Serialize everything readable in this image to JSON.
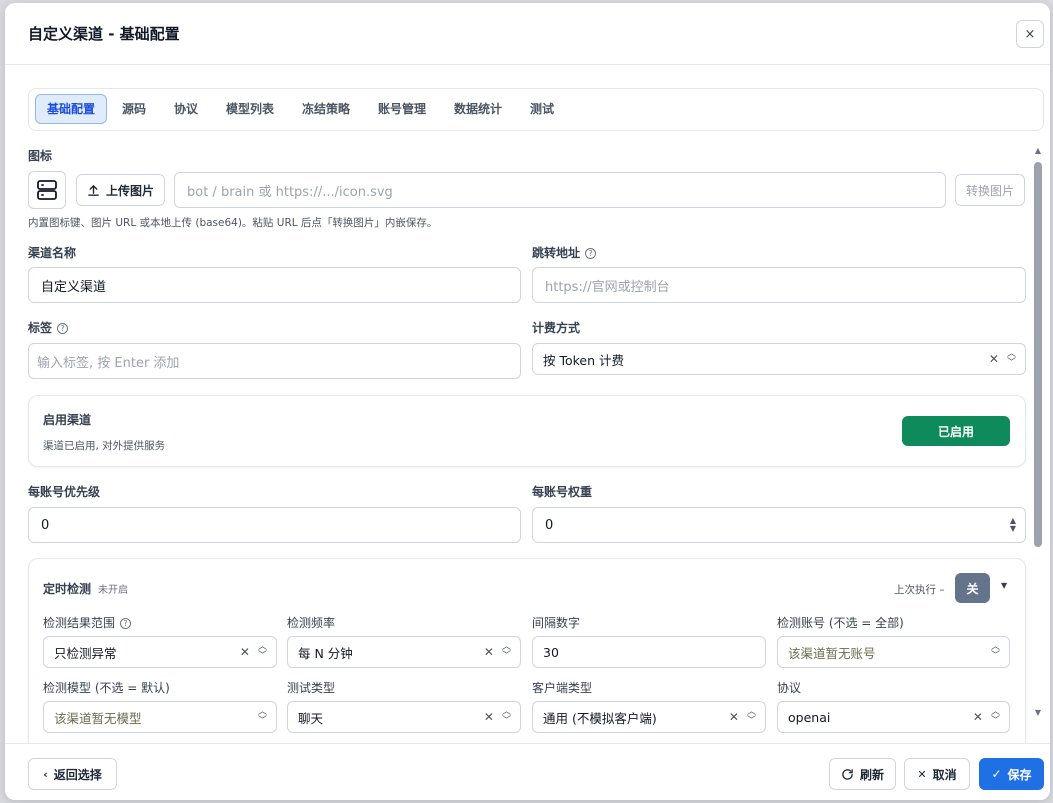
{
  "header": {
    "title": "自定义渠道 - 基础配置",
    "close": "×"
  },
  "tabs": [
    {
      "label": "基础配置",
      "active": true
    },
    {
      "label": "源码"
    },
    {
      "label": "协议"
    },
    {
      "label": "模型列表"
    },
    {
      "label": "冻结策略"
    },
    {
      "label": "账号管理"
    },
    {
      "label": "数据统计"
    },
    {
      "label": "测试"
    }
  ],
  "icon_section": {
    "label": "图标",
    "icon": "server-icon",
    "upload_label": "上传图片",
    "url_placeholder": "bot / brain 或 https://.../icon.svg",
    "convert_label": "转换图片",
    "hint": "内置图标键、图片 URL 或本地上传 (base64)。粘贴 URL 后点「转换图片」内嵌保存。"
  },
  "channel_name": {
    "label": "渠道名称",
    "value": "自定义渠道"
  },
  "redirect_url": {
    "label": "跳转地址",
    "placeholder": "https://官网或控制台"
  },
  "tags": {
    "label": "标签",
    "placeholder": "输入标签, 按 Enter 添加"
  },
  "billing": {
    "label": "计费方式",
    "value": "按 Token 计费"
  },
  "enable_card": {
    "title": "启用渠道",
    "description": "渠道已启用, 对外提供服务",
    "button": "已启用",
    "color": "#0e8a5b"
  },
  "priority": {
    "label": "每账号优先级",
    "value": "0"
  },
  "weight": {
    "label": "每账号权重",
    "value": "0"
  },
  "scheduled_check": {
    "title": "定时检测",
    "status": "未开启",
    "last_run": "上次执行 –",
    "toggle": "关",
    "fields": {
      "result_range": {
        "label": "检测结果范围",
        "value": "只检测异常"
      },
      "frequency": {
        "label": "检测频率",
        "value": "每 N 分钟"
      },
      "interval": {
        "label": "间隔数字",
        "value": "30"
      },
      "accounts": {
        "label": "检测账号 (不选 = 全部)",
        "value": "该渠道暂无账号"
      },
      "model": {
        "label": "检测模型 (不选 = 默认)",
        "value": "该渠道暂无模型"
      },
      "test_type": {
        "label": "测试类型",
        "value": "聊天"
      },
      "client_type": {
        "label": "客户端类型",
        "value": "通用 (不模拟客户端)"
      },
      "protocol": {
        "label": "协议",
        "value": "openai"
      }
    }
  },
  "footer": {
    "back": "返回选择",
    "refresh": "刷新",
    "cancel": "取消",
    "save": "保存"
  },
  "colors": {
    "primary": "#1f6fe5",
    "success": "#0e8a5b",
    "toggle_off": "#64748b"
  }
}
